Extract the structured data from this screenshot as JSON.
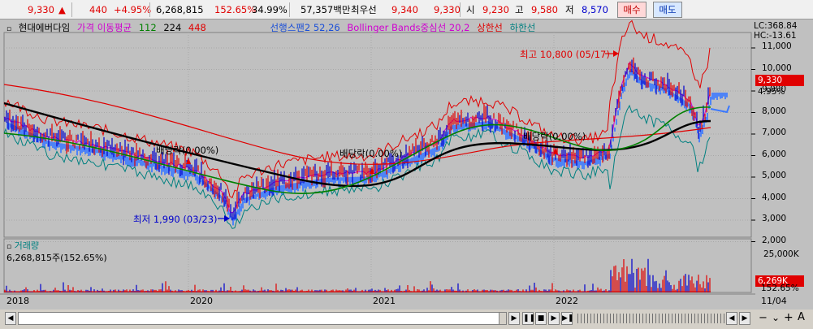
{
  "quote": {
    "price": "9,330",
    "change_arrow": "▲",
    "change": "440",
    "change_pct": "+4.95%",
    "volume": "6,268,815",
    "volume_ratio": "152.65%",
    "turnover": "34.99%",
    "amount": "57,357백만",
    "best_bid_label": "최우선",
    "best_ask": "9,340",
    "best_bid": "9,330",
    "open_label": "시",
    "open": "9,230",
    "high_label": "고",
    "high": "9,580",
    "low_label": "저",
    "low": "8,570",
    "buy_label": "매수",
    "sell_label": "매도"
  },
  "legend": {
    "stock_name": "현대에버다임",
    "ma_label": "가격 이동평균",
    "ma1": "112",
    "ma2": "224",
    "ma3": "448",
    "ichimoku": "선행스팬2 52,26",
    "bollinger": "Bollinger Bands중심선 20,2",
    "upper": "상한선",
    "lower": "하한선"
  },
  "axis": {
    "lc": "LC:368.84",
    "hc": "HC:-13.61",
    "price_ticks": [
      "11,000",
      "10,000",
      "9,000",
      "8,000",
      "7,000",
      "6,000",
      "5,000",
      "4,000",
      "3,000",
      "2,000"
    ],
    "current_price": "9,330",
    "current_pct": "4.95%",
    "vol_tick": "25,000K",
    "vol_current": "6,269K",
    "vol_pct": "152.65%",
    "x_labels": [
      "2018",
      "2020",
      "2021",
      "2022"
    ],
    "last_date": "11/04"
  },
  "annotations": {
    "high": "최고 10,800 (05/17)",
    "low": "최저 1,990 (03/23)",
    "div1": "배당락(0.00%)",
    "div2": "배당락(0.00%)",
    "div3": "배당락(0.00%)"
  },
  "volume_panel": {
    "title": "거래량",
    "value": "6,268,815주(152.65%)"
  },
  "colors": {
    "up": "#e00000",
    "down": "#0000cc",
    "bg": "#c0c0c0"
  }
}
